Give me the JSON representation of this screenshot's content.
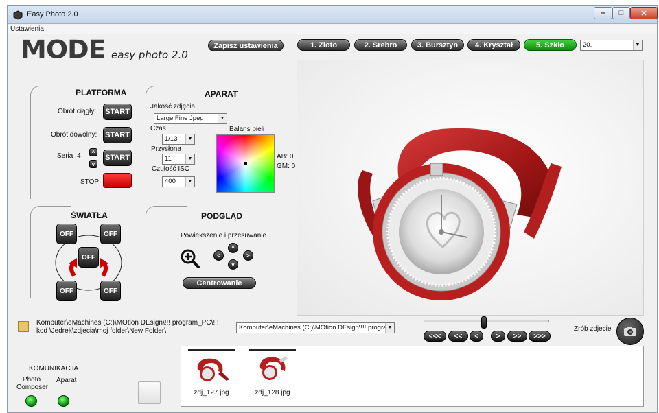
{
  "window": {
    "title": "Easy Photo 2.0",
    "min_glyph": "–",
    "max_glyph": "□",
    "close_glyph": "✕"
  },
  "menu": {
    "settings": "Ustawienia"
  },
  "logo": {
    "brand": "MODE",
    "product": "easy photo 2.0"
  },
  "toolbar": {
    "save_settings": "Zapisz ustawienia",
    "presets": [
      "1. Złoto",
      "2. Srebro",
      "3. Bursztyn",
      "4. Kryształ",
      "5. Szkło"
    ],
    "active_preset_index": 4,
    "preset_select_value": "20."
  },
  "platform": {
    "title": "PLATFORMA",
    "continuous_label": "Obrót ciągły:",
    "free_label": "Obrót dowolny:",
    "series_label": "Seria",
    "series_value": "4",
    "series_up": "^",
    "series_down": "v",
    "start_label": "START",
    "stop_label": "STOP"
  },
  "camera": {
    "title": "APARAT",
    "quality_label": "Jakość zdjęcia",
    "quality_value": "Large Fine Jpeg",
    "time_label": "Czas",
    "time_value": "1/13",
    "aperture_label": "Przysłona",
    "aperture_value": "11",
    "iso_label": "Czułość ISO",
    "iso_value": "400",
    "white_balance_label": "Balans bieli",
    "ab_label": "AB: 0",
    "gm_label": "GM: 0"
  },
  "lights": {
    "title": "ŚWIATŁA",
    "off_label": "OFF"
  },
  "preview": {
    "title": "PODGLĄD",
    "zoom_pan_label": "Powiekszenie i przesuwanie",
    "center_label": "Centrowanie",
    "left": "<",
    "right": ">",
    "up": "^",
    "down": "v"
  },
  "browser": {
    "path_text": "Komputer\\eMachines (C:)\\MOtion DEsign\\!!! program_PC\\!!! kod \\Jedrek\\zdjecia\\moj folder\\New Folder\\",
    "path_select_value": "Komputer\\eMachines (C:)\\MOtion DEsign\\!!! program_PC\\!!! kod",
    "slider_fraction": 0.48,
    "nav": [
      "<<<",
      "<<",
      "<",
      ">",
      ">>",
      ">>>"
    ],
    "take_photo_label": "Zrób zdjecie"
  },
  "thumbnails": [
    {
      "label": "zdj_127.jpg"
    },
    {
      "label": "zdj_128.jpg"
    }
  ],
  "communication": {
    "title": "KOMUNIKACJA",
    "photo_composer_label": "Photo\nComposer",
    "camera_label": "Aparat",
    "colors": {
      "led_on": "#0a9a0a"
    }
  },
  "colors": {
    "accent_green": "#0b8f0b",
    "stop_red": "#e00000",
    "button_dark": "#1e1e1e"
  }
}
